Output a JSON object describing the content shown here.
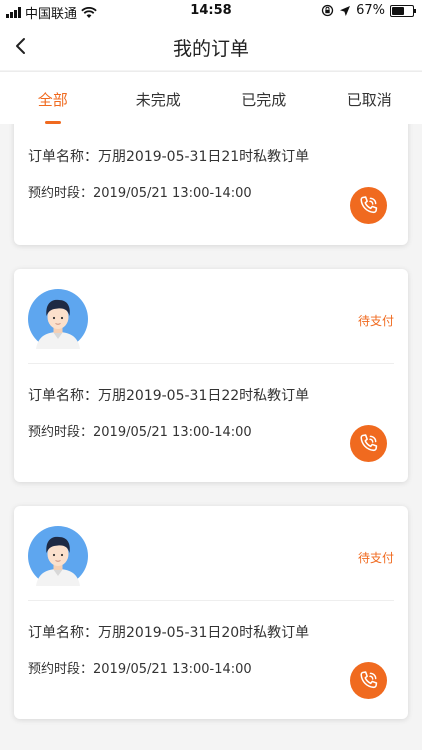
{
  "status_bar": {
    "carrier": "中国联通",
    "time": "14:58",
    "battery": "67%",
    "battery_level": 0.67
  },
  "nav": {
    "title": "我的订单"
  },
  "tabs": [
    {
      "label": "全部",
      "active": true
    },
    {
      "label": "未完成",
      "active": false
    },
    {
      "label": "已完成",
      "active": false
    },
    {
      "label": "已取消",
      "active": false
    }
  ],
  "orders": [
    {
      "status": "",
      "name": "订单名称：万朋2019-05-31日21时私教订单",
      "time": "预约时段：2019/05/21 13:00-14:00"
    },
    {
      "status": "待支付",
      "name": "订单名称：万朋2019-05-31日22时私教订单",
      "time": "预约时段：2019/05/21 13:00-14:00"
    },
    {
      "status": "待支付",
      "name": "订单名称：万朋2019-05-31日20时私教订单",
      "time": "预约时段：2019/05/21 13:00-14:00"
    }
  ],
  "colors": {
    "accent": "#f06a1f",
    "avatar_bg": "#5ea6ef"
  }
}
